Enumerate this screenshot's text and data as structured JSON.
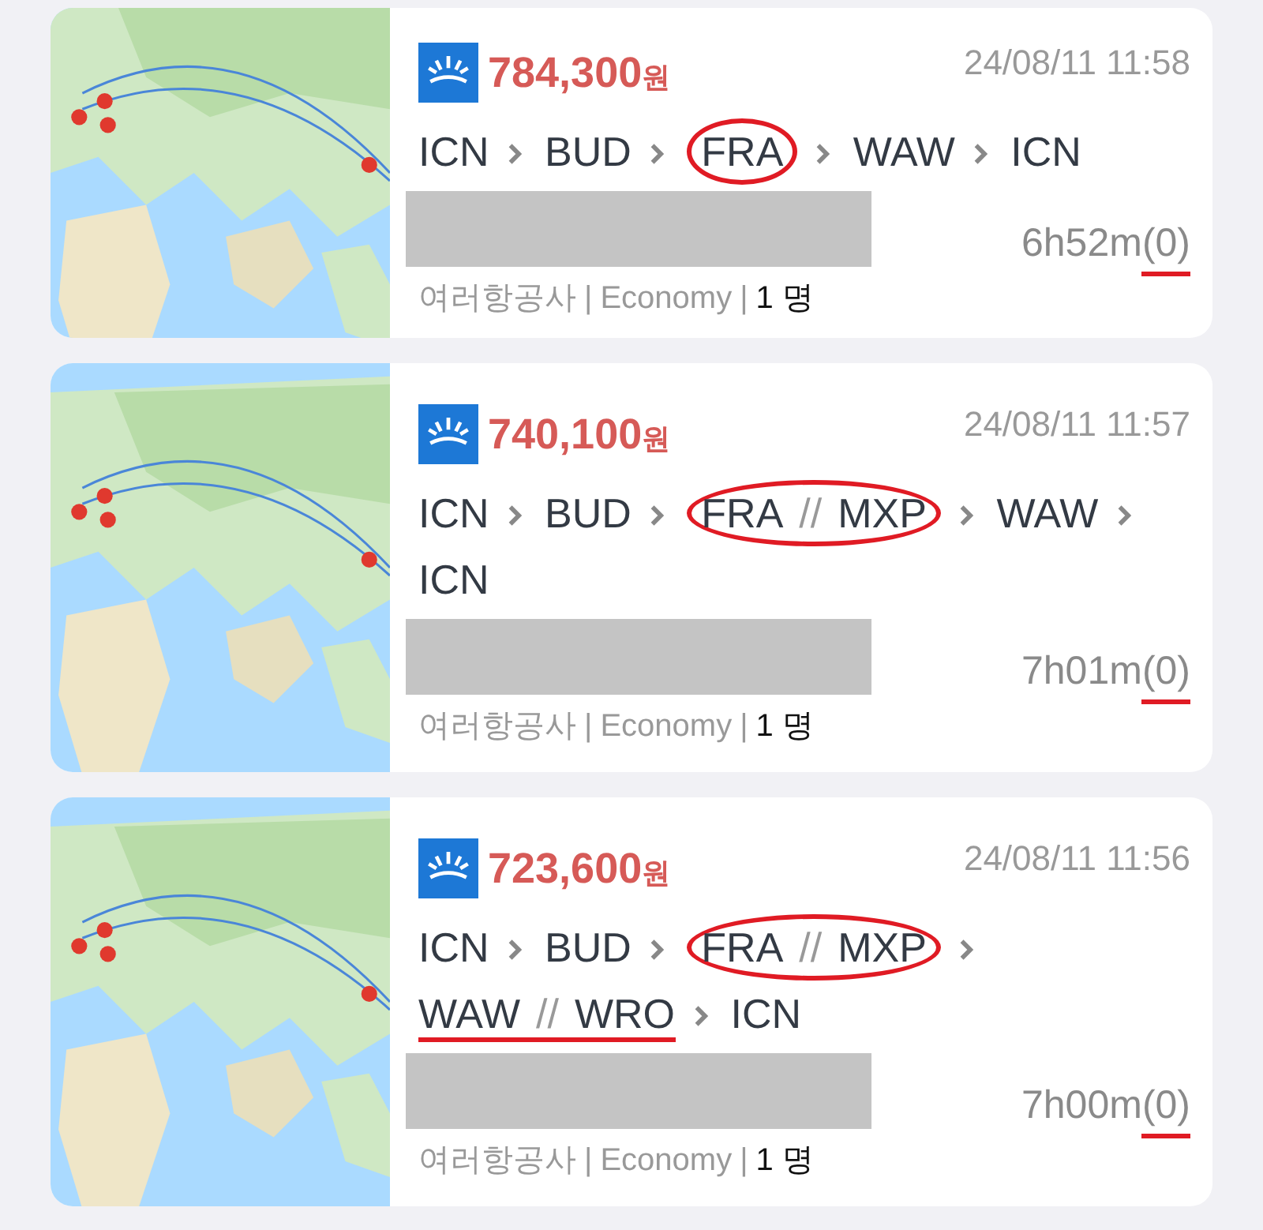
{
  "code_separator": "//",
  "meta_separator": "|",
  "cards": [
    {
      "price": "784,300",
      "currency": "원",
      "timestamp": "24/08/11 11:58",
      "route": [
        {
          "codes": [
            "ICN"
          ],
          "circled": false,
          "underlined": false
        },
        {
          "codes": [
            "BUD"
          ],
          "circled": false,
          "underlined": false
        },
        {
          "codes": [
            "FRA"
          ],
          "circled": true,
          "underlined": false
        },
        {
          "codes": [
            "WAW"
          ],
          "circled": false,
          "underlined": false
        },
        {
          "codes": [
            "ICN"
          ],
          "circled": false,
          "underlined": false
        }
      ],
      "duration": "6h52m",
      "stops": "(0)",
      "stops_marked": true,
      "airline": "여러항공사",
      "cabin": "Economy",
      "passengers": "1 명"
    },
    {
      "price": "740,100",
      "currency": "원",
      "timestamp": "24/08/11 11:57",
      "route": [
        {
          "codes": [
            "ICN"
          ],
          "circled": false,
          "underlined": false
        },
        {
          "codes": [
            "BUD"
          ],
          "circled": false,
          "underlined": false
        },
        {
          "codes": [
            "FRA",
            "MXP"
          ],
          "circled": true,
          "underlined": false
        },
        {
          "codes": [
            "WAW"
          ],
          "circled": false,
          "underlined": false
        },
        {
          "codes": [
            "ICN"
          ],
          "circled": false,
          "underlined": false
        }
      ],
      "duration": "7h01m",
      "stops": "(0)",
      "stops_marked": true,
      "airline": "여러항공사",
      "cabin": "Economy",
      "passengers": "1 명"
    },
    {
      "price": "723,600",
      "currency": "원",
      "timestamp": "24/08/11 11:56",
      "route": [
        {
          "codes": [
            "ICN"
          ],
          "circled": false,
          "underlined": false
        },
        {
          "codes": [
            "BUD"
          ],
          "circled": false,
          "underlined": false
        },
        {
          "codes": [
            "FRA",
            "MXP"
          ],
          "circled": true,
          "underlined": false
        },
        {
          "codes": [
            "WAW",
            "WRO"
          ],
          "circled": false,
          "underlined": true
        },
        {
          "codes": [
            "ICN"
          ],
          "circled": false,
          "underlined": false
        }
      ],
      "duration": "7h00m",
      "stops": "(0)",
      "stops_marked": true,
      "airline": "여러항공사",
      "cabin": "Economy",
      "passengers": "1 명"
    }
  ]
}
